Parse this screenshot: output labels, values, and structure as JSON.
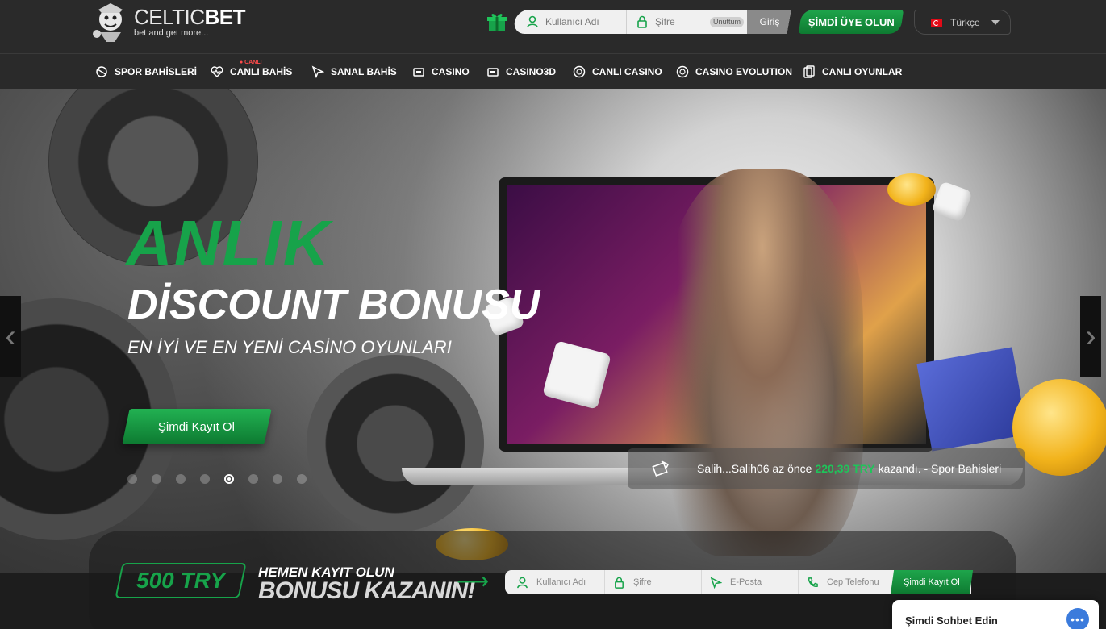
{
  "brand": {
    "name_thin": "CELTIC",
    "name_bold": "BET",
    "tagline": "bet and get more..."
  },
  "header": {
    "username_placeholder": "Kullanıcı Adı",
    "password_placeholder": "Şifre",
    "forgot_label": "Unuttum",
    "login_label": "Giriş",
    "signup_label": "ŞİMDİ ÜYE OLUN",
    "language": "Türkçe"
  },
  "nav": {
    "live_badge": "● CANLI",
    "items": [
      {
        "label": "SPOR BAHİSLERİ",
        "icon": "sports-icon"
      },
      {
        "label": "CANLI BAHİS",
        "icon": "heartbeat-icon"
      },
      {
        "label": "SANAL BAHİS",
        "icon": "cursor-icon"
      },
      {
        "label": "CASINO",
        "icon": "slot-icon"
      },
      {
        "label": "CASINO3D",
        "icon": "slot-icon"
      },
      {
        "label": "CANLI CASINO",
        "icon": "chip-icon"
      },
      {
        "label": "CASINO EVOLUTION",
        "icon": "chip-icon"
      },
      {
        "label": "CANLI OYUNLAR",
        "icon": "cards-icon"
      }
    ]
  },
  "hero": {
    "title_line1": "ANLIK",
    "title_line2": "DİSCOUNT BONUSU",
    "subtitle": "EN İYİ VE EN YENİ CASİNO OYUNLARI",
    "cta_label": "Şimdi Kayıt Ol",
    "slide_count": 8,
    "active_slide": 5
  },
  "ticker": {
    "user": "Salih...Salih06",
    "ago": "az önce",
    "amount": "220,39 TRY",
    "action": "kazandı. - Spor Bahisleri"
  },
  "register": {
    "bonus_amount": "500 TRY",
    "line1": "HEMEN KAYIT OLUN",
    "line2": "BONUSU KAZANIN!",
    "username_placeholder": "Kullanıcı Adı",
    "password_placeholder": "Şifre",
    "email_placeholder": "E-Posta",
    "phone_placeholder": "Cep Telefonu",
    "submit_label": "Şimdi Kayıt Ol"
  },
  "chat": {
    "label": "Şimdi Sohbet Edin",
    "button_icon": "chat-bubble-icon"
  },
  "colors": {
    "accent_green": "#17a34a",
    "header_bg": "#2a2a2a",
    "winnings_green": "#1fc45a"
  }
}
